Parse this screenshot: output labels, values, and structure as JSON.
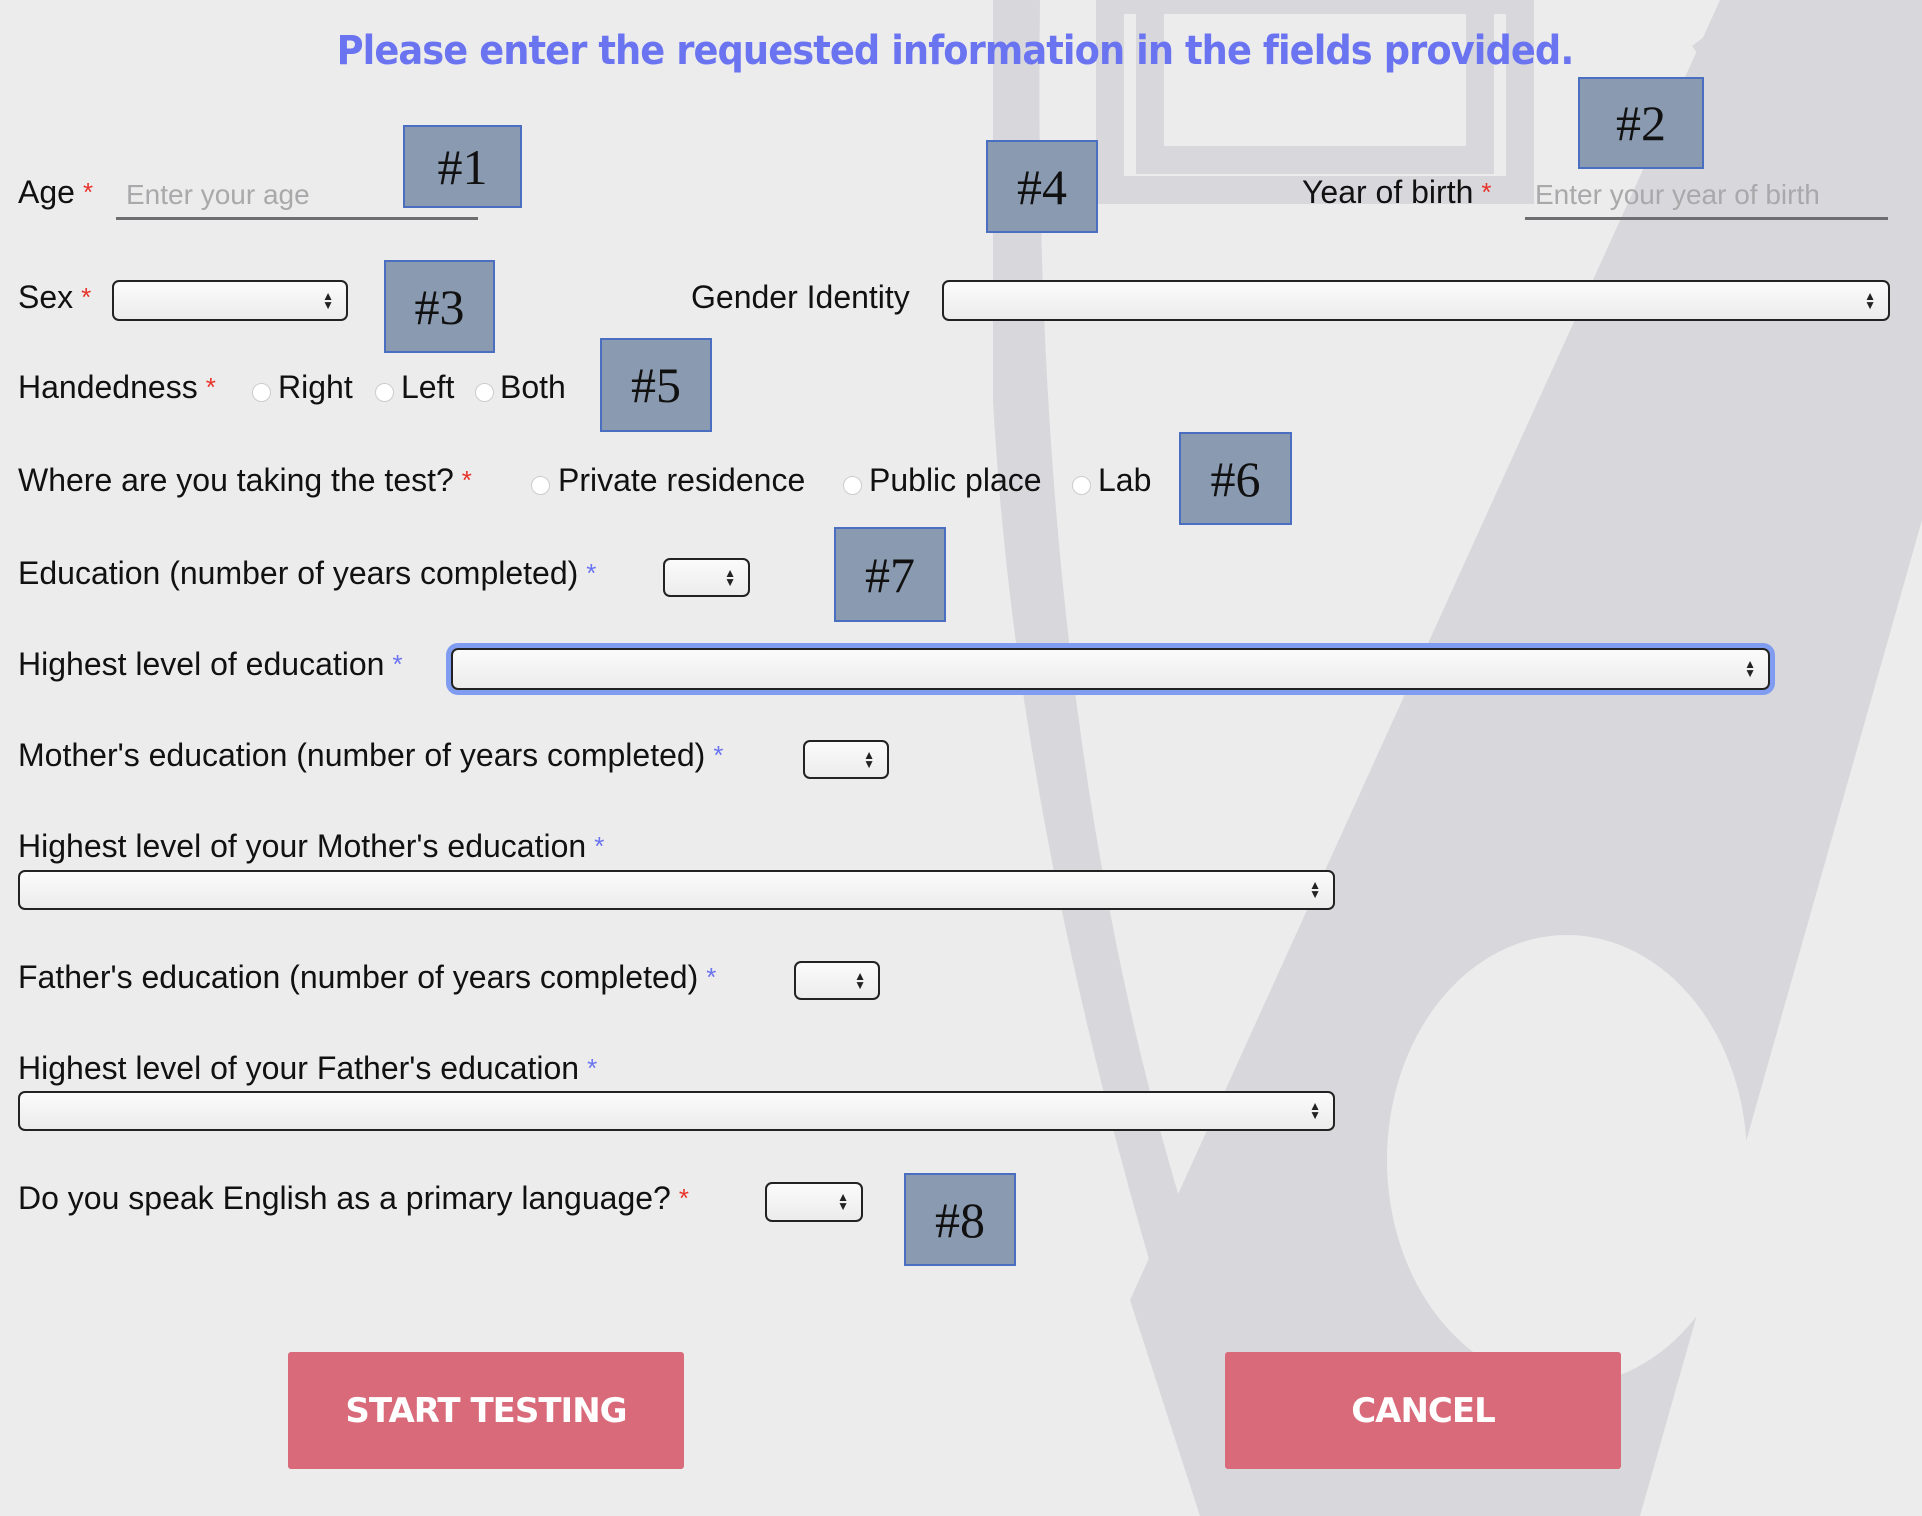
{
  "header": {
    "title": "Please enter the requested information in the fields provided."
  },
  "colors": {
    "title": "#6b74f0",
    "required_red": "#e8332a",
    "required_blue": "#6b74f0",
    "button": "#d96a7a",
    "marker_fill": "#8a9ab0",
    "background": "#ececec"
  },
  "form": {
    "age": {
      "label": "Age",
      "required": "*",
      "placeholder": "Enter your age"
    },
    "year_of_birth": {
      "label": "Year of birth",
      "required": "*",
      "placeholder": "Enter your year of birth"
    },
    "sex": {
      "label": "Sex",
      "required": "*",
      "value": ""
    },
    "gender_identity": {
      "label": "Gender Identity",
      "value": ""
    },
    "handedness": {
      "label": "Handedness",
      "required": "*",
      "options": [
        "Right",
        "Left",
        "Both"
      ]
    },
    "location": {
      "label": "Where are you taking the test?",
      "required": "*",
      "options": [
        "Private residence",
        "Public place",
        "Lab"
      ]
    },
    "education_years": {
      "label": "Education (number of years completed)",
      "required": "*",
      "value": ""
    },
    "highest_education": {
      "label": "Highest level of education",
      "required": "*",
      "value": ""
    },
    "mother_education_years": {
      "label": "Mother's education (number of years completed)",
      "required": "*",
      "value": ""
    },
    "mother_highest_education": {
      "label": "Highest level of your Mother's education",
      "required": "*",
      "value": ""
    },
    "father_education_years": {
      "label": "Father's education (number of years completed)",
      "required": "*",
      "value": ""
    },
    "father_highest_education": {
      "label": "Highest level of your Father's education",
      "required": "*",
      "value": ""
    },
    "english_primary": {
      "label": "Do you speak English as a primary language?",
      "required": "*",
      "value": ""
    }
  },
  "markers": [
    "#1",
    "#2",
    "#3",
    "#4",
    "#5",
    "#6",
    "#7",
    "#8"
  ],
  "buttons": {
    "start": "START TESTING",
    "cancel": "CANCEL"
  }
}
